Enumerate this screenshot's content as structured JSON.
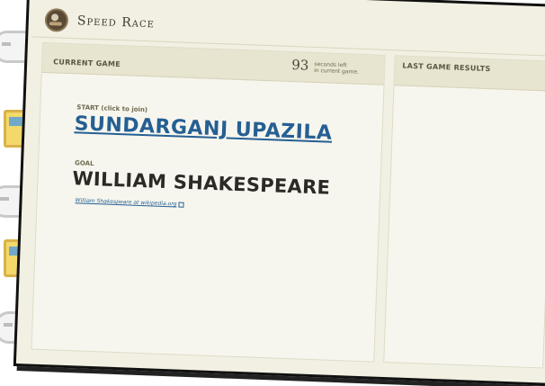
{
  "app": {
    "title": "Speed Race"
  },
  "current_game": {
    "header": "Current Game",
    "seconds_remaining": "93",
    "timer_caption_line1": "seconds left",
    "timer_caption_line2": "in current game.",
    "start_label": "START (click to join)",
    "start_article": "SUNDARGANJ UPAZILA",
    "goal_label": "GOAL",
    "goal_article": "WILLIAM SHAKESPEARE",
    "goal_link": "William Shakespeare at wikipedia.org"
  },
  "last_game": {
    "header": "Last Game Results"
  },
  "icons": [
    "logo-icon",
    "external-link-icon"
  ],
  "colors": {
    "link": "#255f93",
    "panel": "#f2f0e2",
    "header": "#e7e4cf"
  }
}
